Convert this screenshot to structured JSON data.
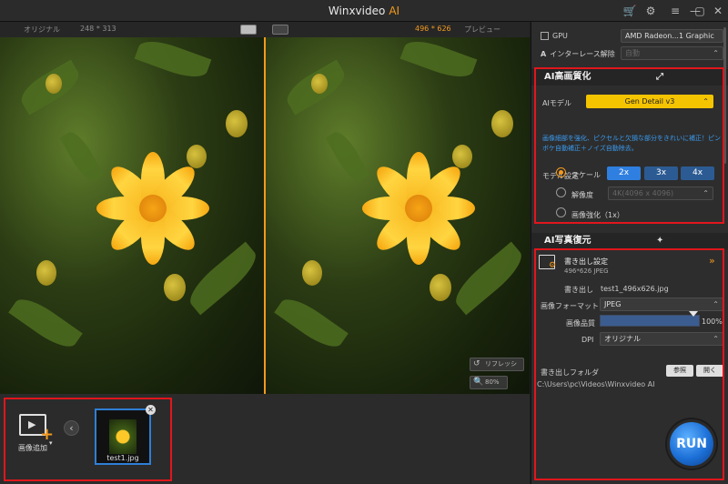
{
  "app": {
    "title": "Winxvideo",
    "title_accent": "AI"
  },
  "titlebar_icons": [
    "cart-icon",
    "gear-icon",
    "menu-icon",
    "minimize-icon",
    "maximize-icon",
    "close-icon"
  ],
  "preview": {
    "left_label": "オリジナル",
    "left_dims": "248 * 313",
    "right_dims": "496 * 626",
    "right_label": "プレビュー",
    "refresh_label": "リフレッシ",
    "zoom": "80%"
  },
  "bottom": {
    "add_label": "画像追加",
    "thumb_name": "test1.jpg"
  },
  "panel": {
    "gpu_label": "GPU",
    "gpu_value": "AMD Radeon...1 Graphic",
    "deinterlace_label": "インターレース解除",
    "deinterlace_value": "自動",
    "ai_section_title": "AI高画質化",
    "ai_model_label": "AIモデル",
    "ai_model_value": "Gen Detail v3",
    "ai_desc": "画像細部を強化、ピクセルと欠損な部分をきれいに補正！ピンボケ自動補正＋ノイズ自動除去。",
    "model_settings_label": "モデル設定",
    "scale_label": "スケール",
    "scale_options": [
      "2x",
      "3x",
      "4x"
    ],
    "resolution_label": "解像度",
    "resolution_value": "4K(4096 x 4096)",
    "enhance_label": "画像強化（1x）",
    "restore_section_title": "AI写真復元",
    "export_title": "書き出し設定",
    "export_info": "496*626  JPEG",
    "export_name_label": "書き出し",
    "export_name_value": "test1_496x626.jpg",
    "format_label": "画像フォーマット",
    "format_value": "JPEG",
    "quality_label": "画像品質",
    "quality_value": "100%",
    "quality_fraction": 1.0,
    "dpi_label": "DPI",
    "dpi_value": "オリジナル",
    "folder_label": "書き出しフォルダ",
    "browse_label": "参照",
    "open_label": "開く",
    "folder_path": "C:\\Users\\pc\\Videos\\Winxvideo AI",
    "run_label": "RUN"
  },
  "colors": {
    "accent": "#f39a1e",
    "highlight_box": "#e0161c",
    "primary_blue": "#2f7fe0",
    "model_badge": "#f5c400"
  }
}
